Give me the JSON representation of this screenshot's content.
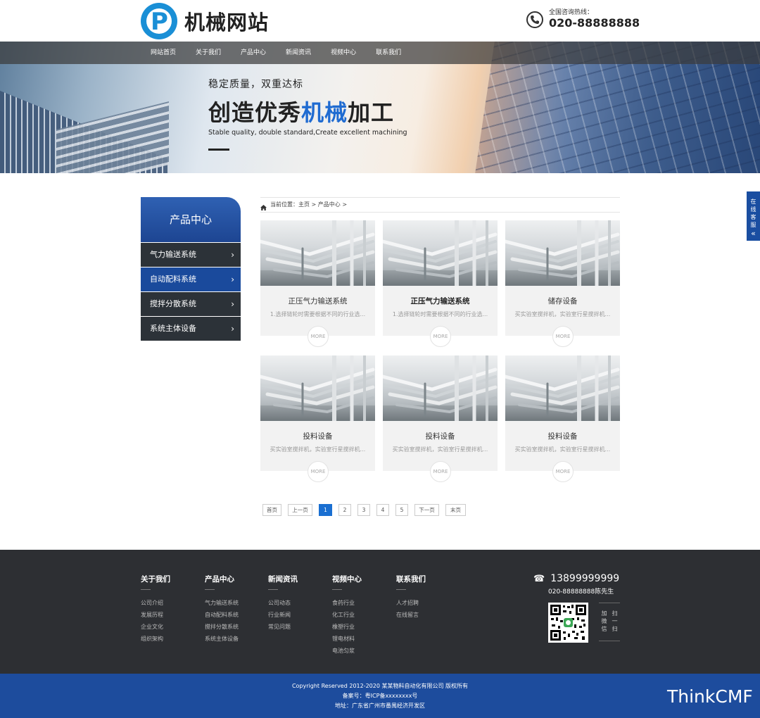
{
  "header": {
    "logo_text": "机械网站",
    "hotline_label": "全国咨询热线：",
    "hotline_number": "020-88888888"
  },
  "nav": {
    "items": [
      "网站首页",
      "关于我们",
      "产品中心",
      "新闻资讯",
      "视频中心",
      "联系我们"
    ]
  },
  "banner": {
    "subtitle": "稳定质量，双重达标",
    "title_a": "创造优秀",
    "title_highlight": "机械",
    "title_b": "加工",
    "english": "Stable quality, double standard,Create excellent machining"
  },
  "float_service": {
    "label": "在线客服",
    "arrow": "«"
  },
  "sidebar": {
    "title": "产品中心",
    "items": [
      {
        "label": "气力输送系统",
        "active": false
      },
      {
        "label": "自动配料系统",
        "active": true
      },
      {
        "label": "搅拌分散系统",
        "active": false
      },
      {
        "label": "系统主体设备",
        "active": false
      }
    ]
  },
  "breadcrumb": {
    "text": "当前位置：主页 > 产品中心 >"
  },
  "products": [
    {
      "title": "正压气力输送系统",
      "desc": "1.选择链轮时需要根据不同的行业选...",
      "more": "MORE",
      "bold": false
    },
    {
      "title": "正压气力输送系统",
      "desc": "1.选择链轮时需要根据不同的行业选...",
      "more": "MORE",
      "bold": true
    },
    {
      "title": "储存设备",
      "desc": "买实验室搅拌机，实验室行星搅拌机...",
      "more": "MORE",
      "bold": false
    },
    {
      "title": "投料设备",
      "desc": "买实验室搅拌机，实验室行星搅拌机...",
      "more": "MORE",
      "bold": false
    },
    {
      "title": "投料设备",
      "desc": "买实验室搅拌机，实验室行星搅拌机...",
      "more": "MORE",
      "bold": false
    },
    {
      "title": "投料设备",
      "desc": "买实验室搅拌机，实验室行星搅拌机...",
      "more": "MORE",
      "bold": false
    }
  ],
  "pagination": {
    "first": "首页",
    "prev": "上一页",
    "pages": [
      "1",
      "2",
      "3",
      "4",
      "5"
    ],
    "current": "1",
    "next": "下一页",
    "last": "末页"
  },
  "footer": {
    "columns": [
      {
        "heading": "关于我们",
        "links": [
          "公司介绍",
          "发展历程",
          "企业文化",
          "组织架构"
        ]
      },
      {
        "heading": "产品中心",
        "links": [
          "气力输送系统",
          "自动配料系统",
          "搅拌分散系统",
          "系统主体设备"
        ]
      },
      {
        "heading": "新闻资讯",
        "links": [
          "公司动态",
          "行业新闻",
          "常见问题"
        ]
      },
      {
        "heading": "视频中心",
        "links": [
          "食药行业",
          "化工行业",
          "橡塑行业",
          "锂电材料",
          "电池匀浆"
        ]
      },
      {
        "heading": "联系我们",
        "links": [
          "人才招聘",
          "在线留言"
        ]
      }
    ],
    "mobile": "13899999999",
    "contact_person": "020-88888888陈先生",
    "qr_caption_1": "扫一扫",
    "qr_caption_2": "加微信"
  },
  "copyright": {
    "line1": "Copyright Reserved 2012-2020 某某物料自动化有限公司 版权所有",
    "line2": "备案号：粤ICP备xxxxxxxx号",
    "line3": "地址：广东省广州市番禺经济开发区"
  },
  "watermark": "ThinkCMF",
  "colors": {
    "brand_blue": "#1a4a9c",
    "accent_blue": "#1f6bd1",
    "footer_dark": "#2d2f33"
  }
}
